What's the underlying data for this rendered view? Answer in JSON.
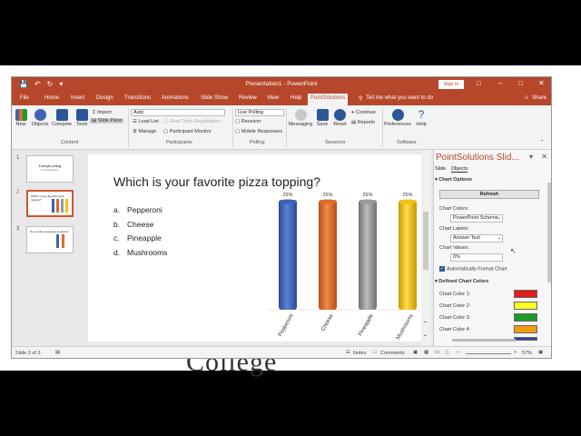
{
  "window": {
    "title": "Presentation1 - PowerPoint",
    "sign_in": "Sign in",
    "qat_icons": [
      "save-icon",
      "undo-icon",
      "redo-icon",
      "customize-icon"
    ],
    "controls": [
      "ribbon-display-icon",
      "minimize-icon",
      "maximize-icon",
      "close-icon"
    ]
  },
  "menu": {
    "tabs": [
      "File",
      "Home",
      "Insert",
      "Design",
      "Transitions",
      "Animations",
      "Slide Show",
      "Review",
      "View",
      "Help",
      "PointSolutions"
    ],
    "active_tab": "PointSolutions",
    "tell_me": "Tell me what you want to do",
    "share": "Share"
  },
  "ribbon": {
    "content": {
      "new": "New",
      "objects": "Objects",
      "compete": "Compete",
      "tools": "Tools",
      "import": "Import",
      "slide_pane": "Slide Pane",
      "label": "Content"
    },
    "participants": {
      "select": "Auto",
      "load_list": "Load List",
      "realtime": "Real-Time Registration",
      "manage": "Manage",
      "monitor": "Participant Monitor",
      "label": "Participants"
    },
    "polling": {
      "select": "Live Polling",
      "receiver": "Receiver",
      "mobile": "Mobile Responses",
      "label": "Polling"
    },
    "sessions": {
      "messaging": "Messaging",
      "save": "Save",
      "reset": "Reset",
      "continue": "Continue",
      "reports": "Reports",
      "label": "Sessions"
    },
    "software": {
      "preferences": "Preferences",
      "help": "Help",
      "label": "Software"
    }
  },
  "thumbnails": [
    {
      "num": "1",
      "text": "Example polling",
      "subtext": "PointSolutions"
    },
    {
      "num": "2",
      "text": "Which is your favorite pizza topping?"
    },
    {
      "num": "3",
      "text": "Do you like pineapple on pizza?"
    }
  ],
  "slide": {
    "question": "Which is your favorite pizza topping?",
    "answers": [
      {
        "letter": "a.",
        "text": "Pepperoni"
      },
      {
        "letter": "b.",
        "text": "Cheese"
      },
      {
        "letter": "c.",
        "text": "Pineapple"
      },
      {
        "letter": "d.",
        "text": "Mushrooms"
      }
    ]
  },
  "chart_data": {
    "type": "bar",
    "categories": [
      "Pepperoni",
      "Cheese",
      "Pineapple",
      "Mushrooms"
    ],
    "values": [
      25,
      25,
      25,
      25
    ],
    "data_labels": [
      "25%",
      "25%",
      "25%",
      "25%"
    ],
    "colors": [
      "#3d64b4",
      "#e06a2b",
      "#9a9a9a",
      "#f2c218"
    ],
    "ylim": [
      0,
      25
    ],
    "grid": false,
    "legend": "none"
  },
  "pane": {
    "title": "PointSolutions Slid...",
    "tabs": [
      "Slide",
      "Objects"
    ],
    "chart_options": "Chart Options",
    "refresh": "Refresh",
    "chart_colors_label": "Chart Colors:",
    "chart_colors_value": "PowerPoint Scheme",
    "chart_labels_label": "Chart Labels:",
    "chart_labels_value": "Answer Text",
    "chart_values_label": "Chart Values:",
    "chart_values_value": "0%",
    "auto_format": "Automatically Format Chart",
    "defined_colors": "Defined Chart Colors",
    "color_rows": [
      {
        "label": "Chart Color 1:",
        "color": "#e31b1b"
      },
      {
        "label": "Chart Color 2:",
        "color": "#ffff1f"
      },
      {
        "label": "Chart Color 3:",
        "color": "#1a9a2a"
      },
      {
        "label": "Chart Color 4:",
        "color": "#f39c12"
      },
      {
        "label": "",
        "color": "#2a3fa0"
      }
    ]
  },
  "status": {
    "slide": "Slide 2 of 3",
    "notes": "Notes",
    "comments": "Comments",
    "zoom": "57%"
  },
  "background": {
    "ghost_text": "College"
  }
}
